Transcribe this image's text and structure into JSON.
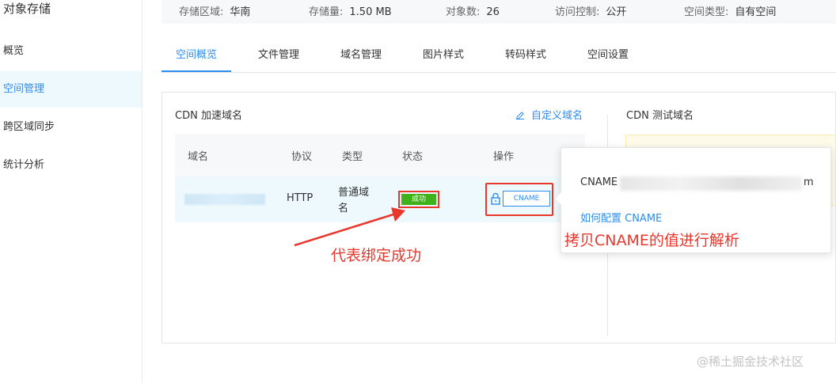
{
  "sidebar": {
    "title": "对象存储",
    "items": [
      {
        "label": "概览"
      },
      {
        "label": "空间管理"
      },
      {
        "label": "跨区域同步"
      },
      {
        "label": "统计分析"
      }
    ]
  },
  "info_bar": {
    "region_label": "存储区域:",
    "region_value": "华南",
    "storage_label": "存储量:",
    "storage_value": "1.50 MB",
    "objects_label": "对象数:",
    "objects_value": "26",
    "access_label": "访问控制:",
    "access_value": "公开",
    "space_type_label": "空间类型:",
    "space_type_value": "自有空间"
  },
  "tabs": [
    {
      "label": "空间概览"
    },
    {
      "label": "文件管理"
    },
    {
      "label": "域名管理"
    },
    {
      "label": "图片样式"
    },
    {
      "label": "转码样式"
    },
    {
      "label": "空间设置"
    }
  ],
  "cdn_panel": {
    "title": "CDN 加速域名",
    "custom_domain_label": "自定义域名",
    "columns": [
      "域名",
      "协议",
      "类型",
      "状态",
      "操作"
    ],
    "row": {
      "protocol": "HTTP",
      "type_line1": "普通域",
      "type_line2": "名",
      "status": "成功",
      "action": "CNAME"
    }
  },
  "test_panel": {
    "title": "CDN 测试域名"
  },
  "popover": {
    "cname_label": "CNAME",
    "cname_tail": "m",
    "how_to_link": "如何配置 CNAME",
    "annotation": "拷贝CNAME的值进行解析"
  },
  "annotation_left": "代表绑定成功",
  "watermark": "@稀土掘金技术社区",
  "colors": {
    "accent": "#2d8cf0",
    "annotation": "#e8372d",
    "success": "#3fb21b"
  }
}
